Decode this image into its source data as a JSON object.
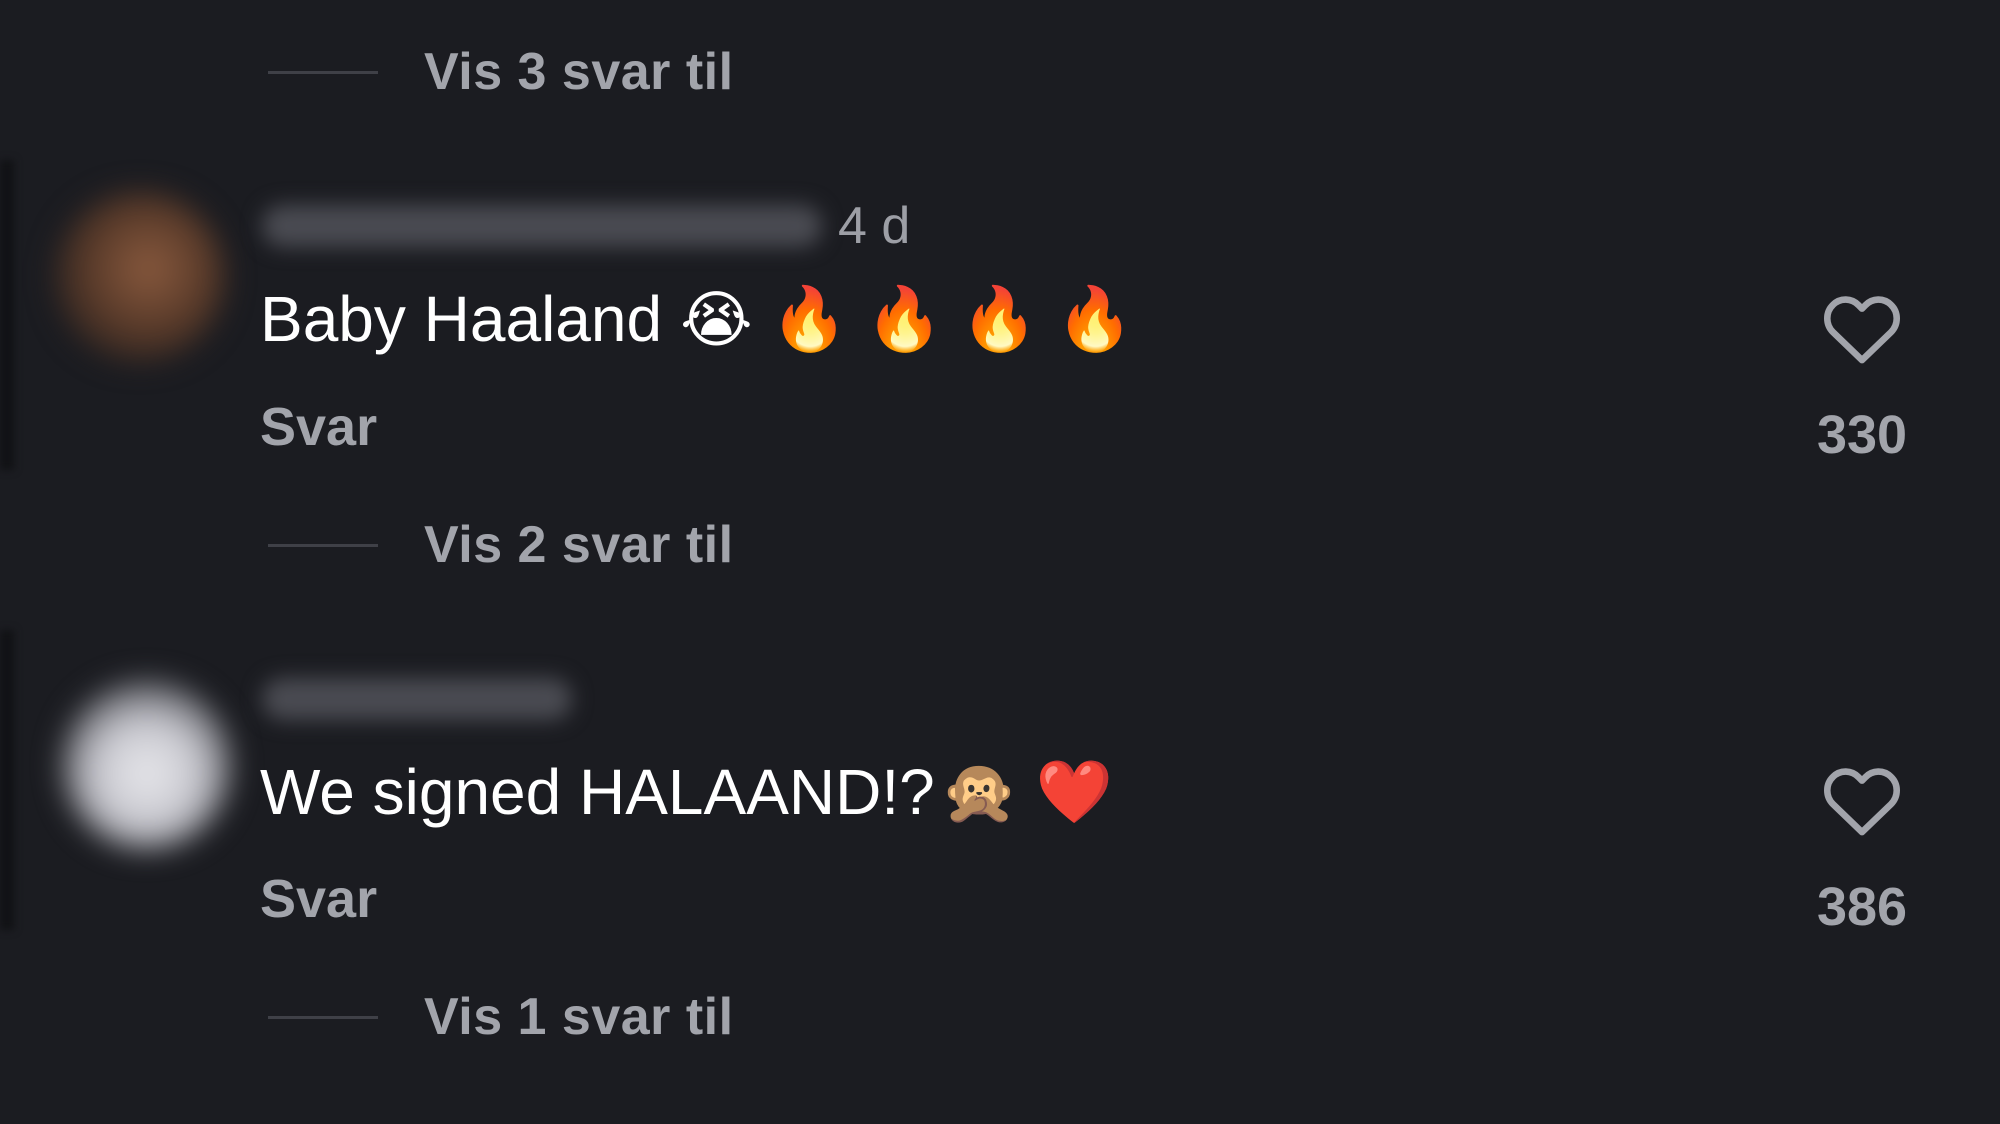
{
  "thread_top": {
    "more_replies_label": "Vis 3 svar til"
  },
  "comments": [
    {
      "time": "4 d",
      "text": "Baby Haaland",
      "emojis": [
        "😭",
        "🔥",
        "🔥",
        "🔥",
        "🔥"
      ],
      "reply_label": "Svar",
      "like_count": "330",
      "more_replies_label": "Vis 2 svar til"
    },
    {
      "text": "We signed HALAAND!?",
      "emojis": [
        "🙊",
        "❤️"
      ],
      "reply_label": "Svar",
      "like_count": "386",
      "more_replies_label": "Vis 1 svar til"
    }
  ],
  "icons": {
    "like": "heart-outline-icon"
  },
  "colors": {
    "background": "#1b1c21",
    "secondary_text": "#a2a4ab"
  }
}
